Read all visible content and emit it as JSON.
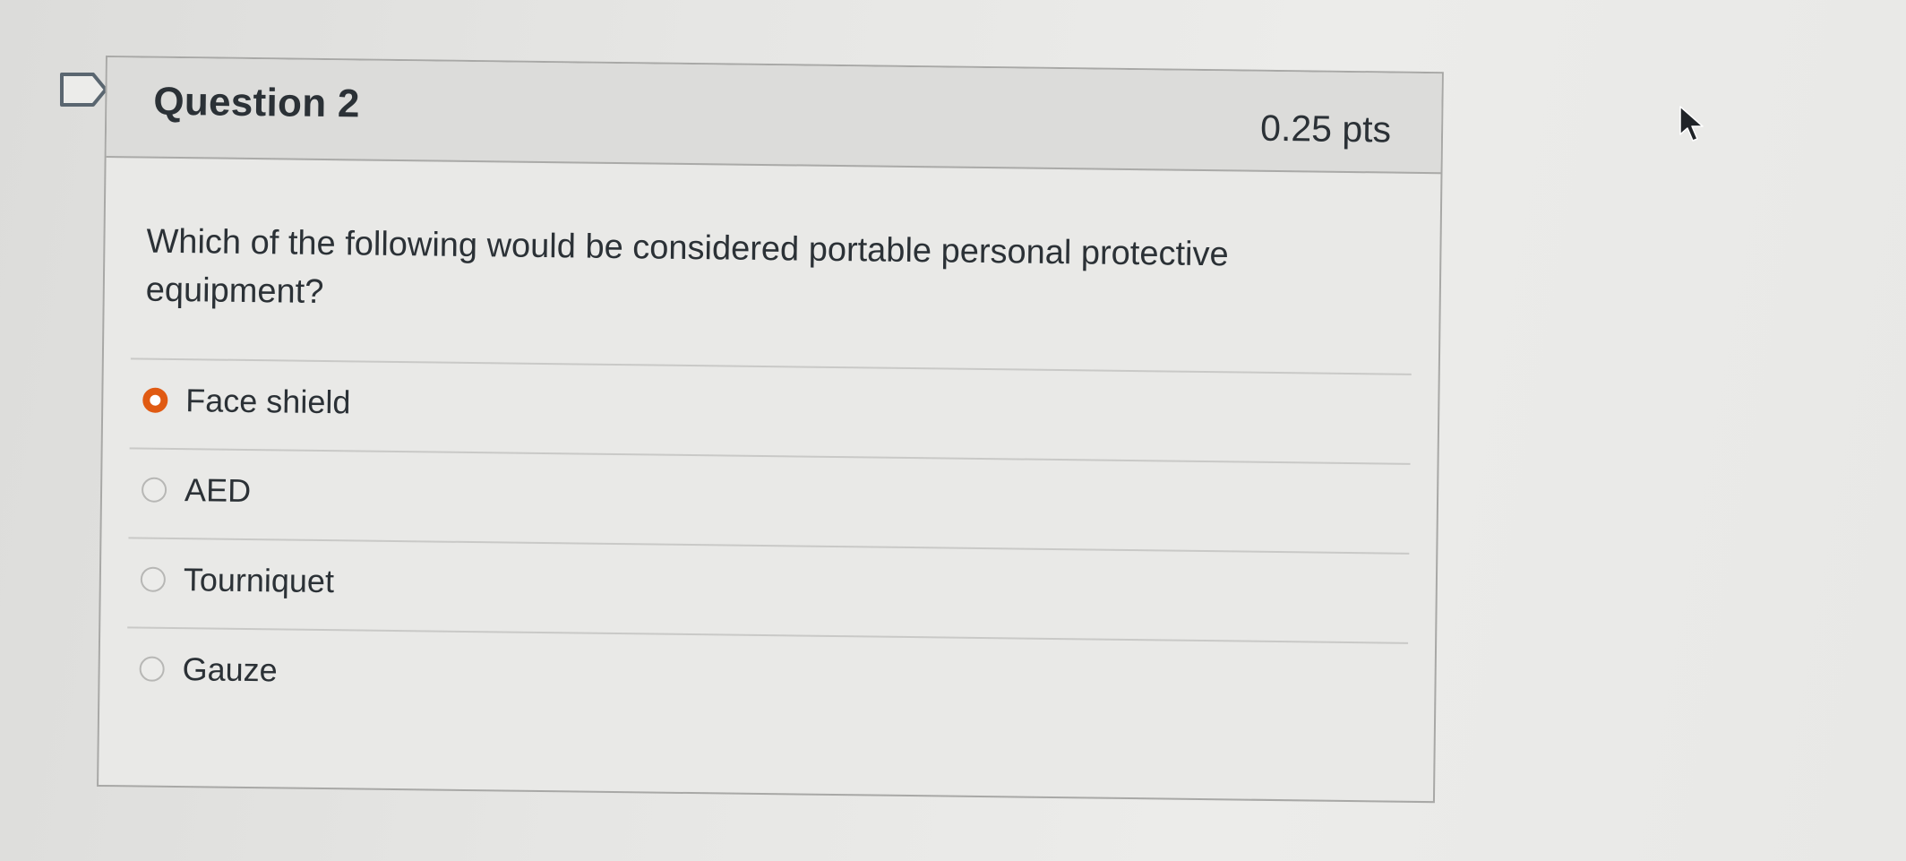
{
  "question": {
    "title": "Question 2",
    "points": "0.25 pts",
    "text": "Which of the following would be considered portable personal protective equipment?",
    "answers": [
      {
        "label": "Face shield",
        "selected": true
      },
      {
        "label": "AED",
        "selected": false
      },
      {
        "label": "Tourniquet",
        "selected": false
      },
      {
        "label": "Gauze",
        "selected": false
      }
    ]
  },
  "icons": {
    "flag": "flag-outline-icon",
    "cursor": "mouse-pointer-icon"
  },
  "colors": {
    "selected_radio": "#e05a12",
    "text": "#2b3136",
    "border": "#a8a8a6"
  }
}
